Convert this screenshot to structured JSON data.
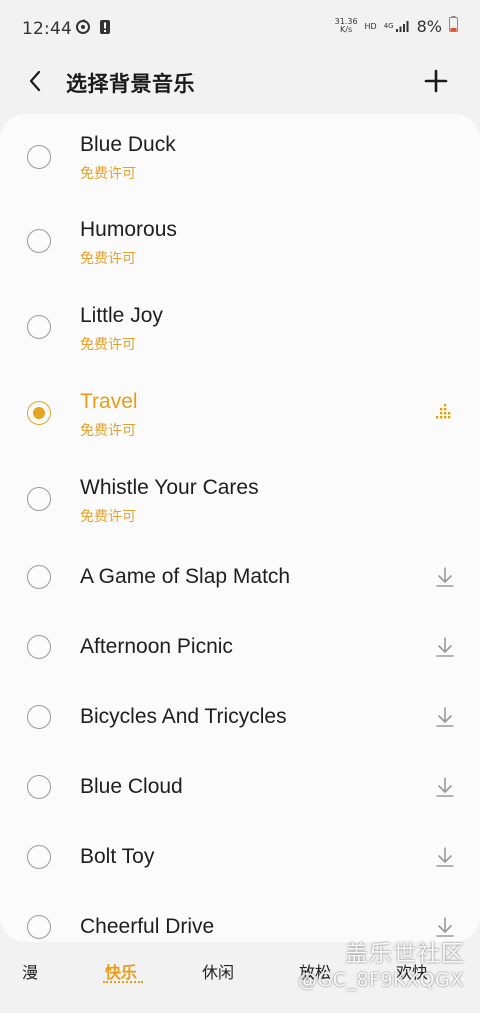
{
  "status_bar": {
    "time": "12:44",
    "net_speed_value": "31.36",
    "net_speed_unit": "K/s",
    "hd_label": "HD",
    "network_type": "4G",
    "battery_percent": "8%"
  },
  "app_bar": {
    "title": "选择背景音乐"
  },
  "tracks": [
    {
      "name": "Blue Duck",
      "subtitle": "免费许可",
      "selected": false,
      "action": "none"
    },
    {
      "name": "Humorous",
      "subtitle": "免费许可",
      "selected": false,
      "action": "none"
    },
    {
      "name": "Little Joy",
      "subtitle": "免费许可",
      "selected": false,
      "action": "none"
    },
    {
      "name": "Travel",
      "subtitle": "免费许可",
      "selected": true,
      "action": "playing"
    },
    {
      "name": "Whistle Your Cares",
      "subtitle": "免费许可",
      "selected": false,
      "action": "none"
    },
    {
      "name": "A Game of Slap Match",
      "subtitle": "",
      "selected": false,
      "action": "download"
    },
    {
      "name": "Afternoon Picnic",
      "subtitle": "",
      "selected": false,
      "action": "download"
    },
    {
      "name": "Bicycles And Tricycles",
      "subtitle": "",
      "selected": false,
      "action": "download"
    },
    {
      "name": "Blue Cloud",
      "subtitle": "",
      "selected": false,
      "action": "download"
    },
    {
      "name": "Bolt Toy",
      "subtitle": "",
      "selected": false,
      "action": "download"
    },
    {
      "name": "Cheerful Drive",
      "subtitle": "",
      "selected": false,
      "action": "download"
    }
  ],
  "tabs": [
    {
      "label": "漫",
      "active": false
    },
    {
      "label": "快乐",
      "active": true
    },
    {
      "label": "休闲",
      "active": false
    },
    {
      "label": "放松",
      "active": false
    },
    {
      "label": "欢快",
      "active": false
    }
  ],
  "watermark": {
    "logo_text": "盖乐世社区",
    "user_text": "@GC_8F9KXQGX"
  },
  "colors": {
    "accent": "#e59e1c",
    "background": "#f2f2f2",
    "card": "#fbfbfb",
    "icon_gray": "#9a9a9a"
  },
  "icons": {
    "back": "chevron-left-icon",
    "add": "plus-icon",
    "download": "download-icon",
    "playing": "equalizer-icon"
  }
}
